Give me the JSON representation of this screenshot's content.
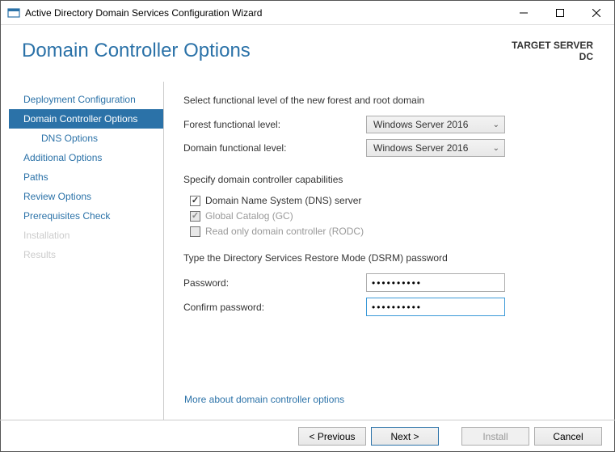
{
  "window": {
    "title": "Active Directory Domain Services Configuration Wizard"
  },
  "header": {
    "title": "Domain Controller Options",
    "target_label": "TARGET SERVER",
    "target_value": "DC"
  },
  "sidebar": {
    "items": [
      {
        "label": "Deployment Configuration"
      },
      {
        "label": "Domain Controller Options"
      },
      {
        "label": "DNS Options"
      },
      {
        "label": "Additional Options"
      },
      {
        "label": "Paths"
      },
      {
        "label": "Review Options"
      },
      {
        "label": "Prerequisites Check"
      },
      {
        "label": "Installation"
      },
      {
        "label": "Results"
      }
    ]
  },
  "content": {
    "functional_level_heading": "Select functional level of the new forest and root domain",
    "forest_label": "Forest functional level:",
    "forest_value": "Windows Server 2016",
    "domain_label": "Domain functional level:",
    "domain_value": "Windows Server 2016",
    "capabilities_heading": "Specify domain controller capabilities",
    "dns_label": "Domain Name System (DNS) server",
    "gc_label": "Global Catalog (GC)",
    "rodc_label": "Read only domain controller (RODC)",
    "dsrm_heading": "Type the Directory Services Restore Mode (DSRM) password",
    "password_label": "Password:",
    "password_value": "••••••••••",
    "confirm_label": "Confirm password:",
    "confirm_value": "••••••••••",
    "more_link": "More about domain controller options"
  },
  "footer": {
    "previous": "< Previous",
    "next": "Next >",
    "install": "Install",
    "cancel": "Cancel"
  }
}
